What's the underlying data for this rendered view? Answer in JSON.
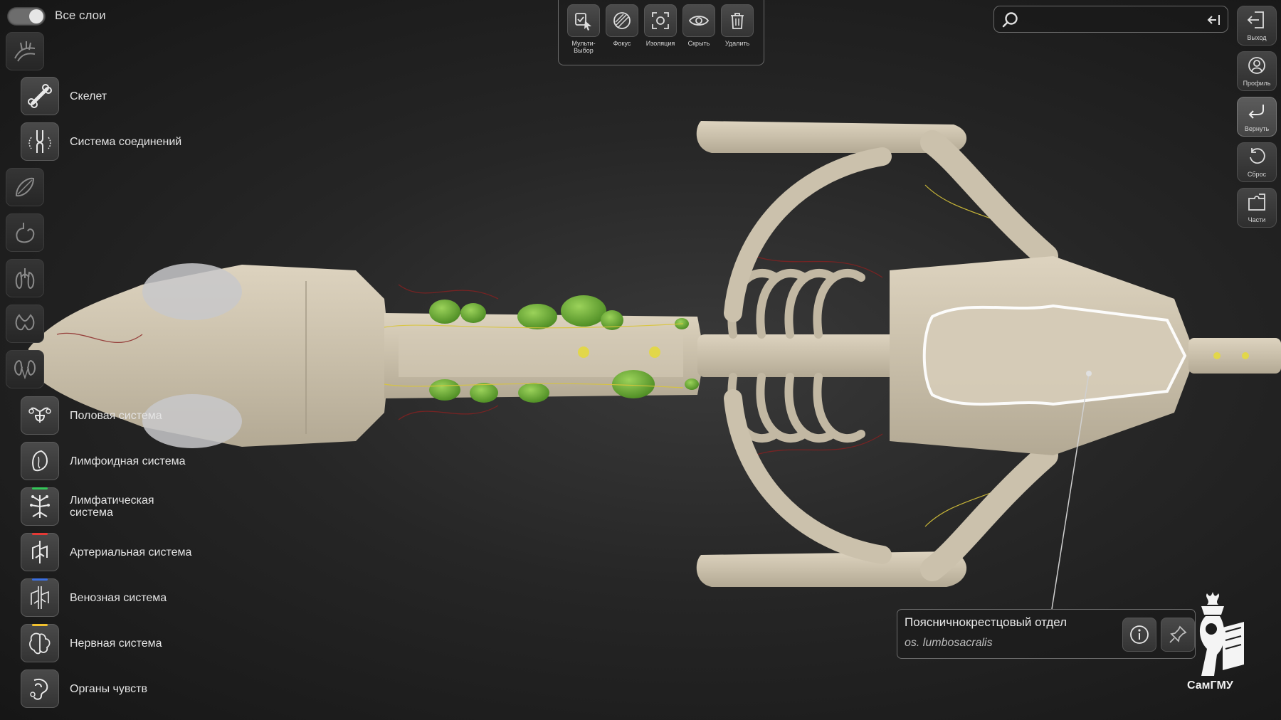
{
  "layers": {
    "all_label": "Все слои",
    "items": [
      {
        "label": "",
        "icon": "skin-icon"
      },
      {
        "label": "Скелет",
        "icon": "bone-icon"
      },
      {
        "label": "Система соединений",
        "icon": "joint-icon"
      },
      {
        "label": "",
        "icon": "muscle-icon"
      },
      {
        "label": "",
        "icon": "stomach-icon"
      },
      {
        "label": "",
        "icon": "lungs-icon"
      },
      {
        "label": "",
        "icon": "thyroid-icon"
      },
      {
        "label": "",
        "icon": "kidneys-icon"
      },
      {
        "label": "Половая система",
        "icon": "uterus-icon"
      },
      {
        "label": "Лимфоидная система",
        "icon": "spleen-icon"
      },
      {
        "label": "Лимфатическая система",
        "icon": "lymph-tree-icon"
      },
      {
        "label": "Артериальная система",
        "icon": "artery-icon"
      },
      {
        "label": "Венозная система",
        "icon": "vein-icon"
      },
      {
        "label": "Нервная система",
        "icon": "brain-icon"
      },
      {
        "label": "Органы чувств",
        "icon": "sense-organs-icon"
      }
    ],
    "stripe_colors": {
      "lymph": "#34c759",
      "artery": "#e53935",
      "vein": "#3b6fe0",
      "nerve": "#f2c12e"
    }
  },
  "toolbar": {
    "items": [
      {
        "label": "Мульти-Выбор",
        "icon": "multi-select-icon"
      },
      {
        "label": "Фокус",
        "icon": "focus-icon"
      },
      {
        "label": "Изоляция",
        "icon": "isolate-icon"
      },
      {
        "label": "Скрыть",
        "icon": "hide-eye-icon"
      },
      {
        "label": "Удалить",
        "icon": "trash-icon"
      }
    ]
  },
  "search": {
    "placeholder": "",
    "value": ""
  },
  "right_panel": {
    "items": [
      {
        "label": "Выход",
        "icon": "exit-icon"
      },
      {
        "label": "Профиль",
        "icon": "profile-icon"
      },
      {
        "label": "Вернуть",
        "icon": "undo-icon"
      },
      {
        "label": "Сброс",
        "icon": "reset-icon"
      },
      {
        "label": "Части",
        "icon": "parts-icon"
      }
    ]
  },
  "selection": {
    "name": "Пояснично­крестцовый отдел",
    "name_display": "Пояснично­крестцовый отдел",
    "latin": "os. lumbosacralis"
  },
  "brand": {
    "name": "СамГМУ"
  },
  "colors": {
    "bone": "#cfc5b0",
    "lymph_node": "#6fae3a",
    "nerve": "#d9c53a",
    "vessel": "#8a2020",
    "accent_glow": "#ffffff"
  }
}
